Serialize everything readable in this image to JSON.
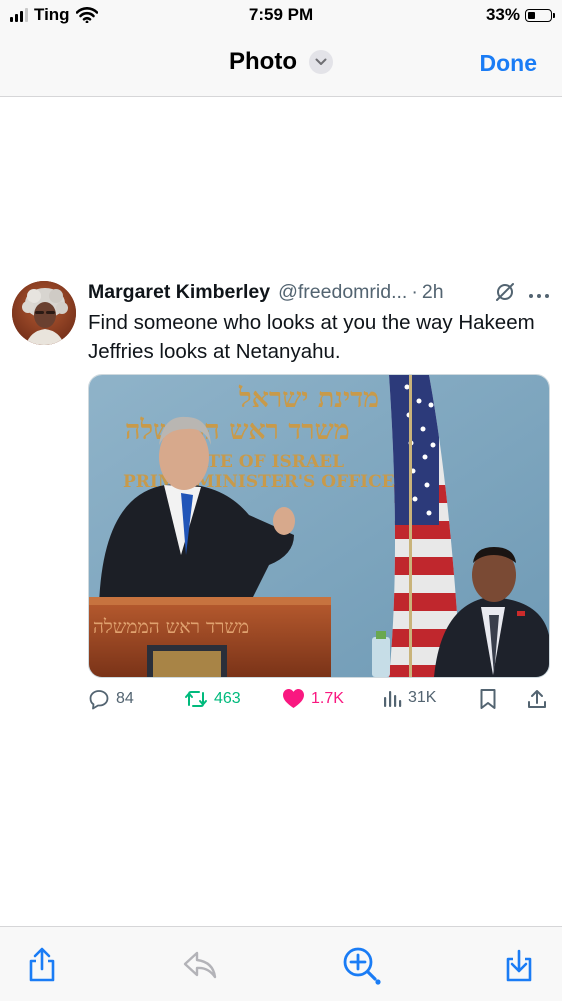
{
  "status_bar": {
    "carrier": "Ting",
    "time": "7:59 PM",
    "battery_percent": "33%",
    "battery_level": 0.33,
    "wifi_icon": "wifi-icon",
    "signal_bars": 3
  },
  "nav": {
    "title": "Photo",
    "title_menu_icon": "chevron-down-icon",
    "done_label": "Done"
  },
  "tweet": {
    "author_name": "Margaret Kimberley",
    "handle": "@freedomrid...",
    "separator": "·",
    "time_ago": "2h",
    "text": "Find someone who looks at you the way Hakeem Jeffries looks at Netanyahu.",
    "media": {
      "sign_hebrew_line1": "מדינת ישראל",
      "sign_hebrew_line2": "משרד ראש הממשלה",
      "sign_english_line1": "STATE OF ISRAEL",
      "sign_english_line2": "PRIME MINISTER'S OFFICE",
      "podium_hebrew": "משרד ראש הממשלה"
    },
    "stats": {
      "replies": "84",
      "retweets": "463",
      "likes": "1.7K",
      "views": "31K"
    }
  },
  "colors": {
    "accent": "#1a7cf5",
    "retweet": "#00ba7c",
    "like": "#f91880",
    "muted": "#536471"
  },
  "toolbar": {
    "icons": [
      "share-icon",
      "reply-arrow-icon",
      "zoom-in-icon",
      "download-icon"
    ]
  }
}
